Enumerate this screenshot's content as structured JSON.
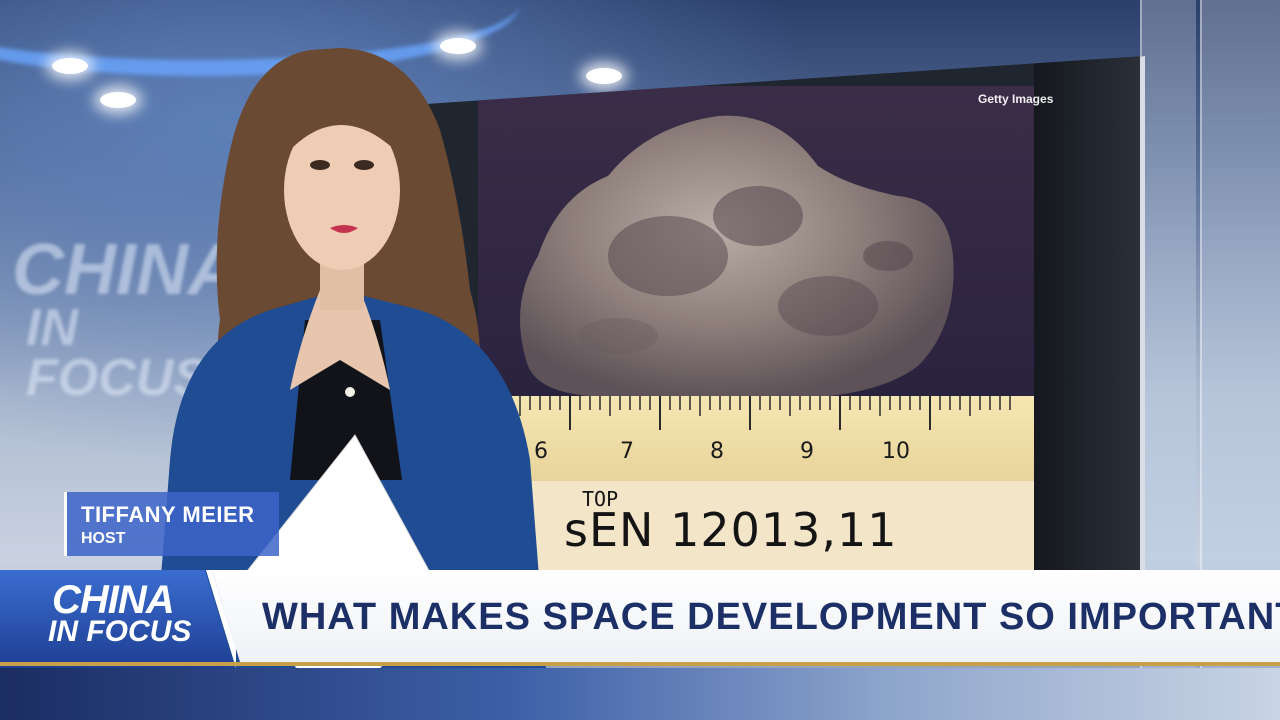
{
  "background": {
    "watermark_line1": "CHINA",
    "watermark_line2": "IN FOCUS"
  },
  "monitor": {
    "credit": "Getty Images",
    "ruler_numbers": [
      "6",
      "7",
      "8",
      "9",
      "10"
    ],
    "sample_tag_top": "TOP",
    "sample_tag_id": "sEN 12013,11"
  },
  "name_tag": {
    "name": "TIFFANY MEIER",
    "role": "HOST"
  },
  "lower_third": {
    "logo_line1": "CHINA",
    "logo_line2": "IN FOCUS",
    "headline": "WHAT MAKES SPACE DEVELOPMENT SO IMPORTANT?"
  },
  "colors": {
    "brand_blue": "#2a55b8",
    "headline_navy": "#1c2f66",
    "accent_gold": "#c7a14a"
  }
}
